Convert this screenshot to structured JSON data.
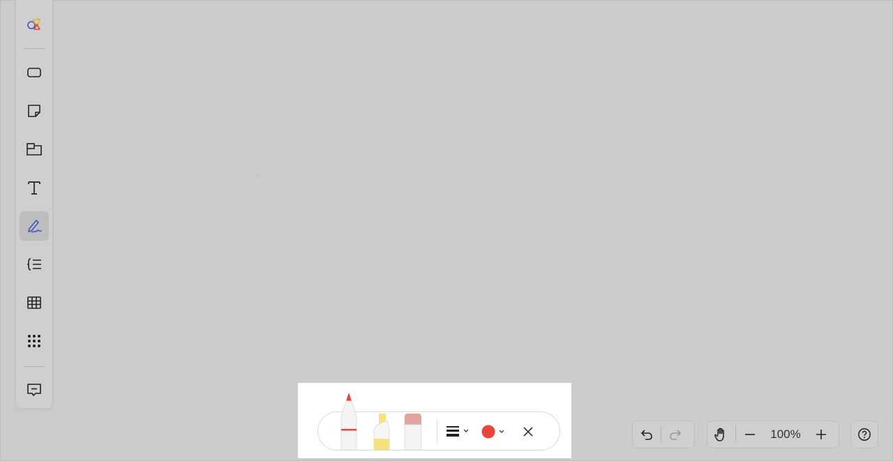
{
  "left_toolbar": {
    "tools": [
      {
        "name": "shapes-logo",
        "icon": "shapes-logo-icon"
      },
      {
        "name": "rectangle",
        "icon": "rectangle-icon"
      },
      {
        "name": "sticky-note",
        "icon": "sticky-note-icon"
      },
      {
        "name": "frame",
        "icon": "frame-icon"
      },
      {
        "name": "text",
        "icon": "text-icon"
      },
      {
        "name": "pen",
        "icon": "pen-icon",
        "active": true
      },
      {
        "name": "mindmap",
        "icon": "mindmap-icon"
      },
      {
        "name": "table",
        "icon": "table-icon"
      },
      {
        "name": "more",
        "icon": "grid-dots-icon"
      },
      {
        "name": "comment",
        "icon": "comment-icon"
      }
    ]
  },
  "pen_toolbar": {
    "tools": [
      "pen",
      "highlighter",
      "eraser"
    ],
    "selected_color": "#e8453c",
    "stroke_icon": "stroke-width-icon",
    "close_icon": "close-icon"
  },
  "controls": {
    "zoom_label": "100%"
  },
  "colors": {
    "canvas_bg": "#cccccc",
    "active_pen_blue": "#3a55c7",
    "pen_red": "#e8453c",
    "highlighter_yellow": "#f5e27a"
  }
}
